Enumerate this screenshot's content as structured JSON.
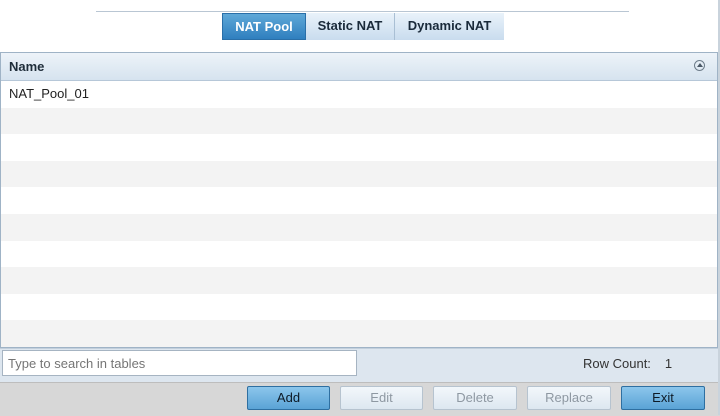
{
  "tabs": [
    {
      "label": "NAT Pool",
      "active": true
    },
    {
      "label": "Static NAT",
      "active": false
    },
    {
      "label": "Dynamic NAT",
      "active": false
    }
  ],
  "table": {
    "column_header": "Name",
    "sort_icon": "sort-ascending-icon",
    "rows": [
      "NAT_Pool_01",
      "",
      "",
      "",
      "",
      "",
      "",
      "",
      "",
      ""
    ]
  },
  "search": {
    "placeholder": "Type to search in tables",
    "value": ""
  },
  "row_count": {
    "label": "Row Count:",
    "value": "1"
  },
  "buttons": {
    "add": "Add",
    "edit": "Edit",
    "delete": "Delete",
    "replace": "Replace",
    "exit": "Exit"
  },
  "colors": {
    "accent": "#2f7fbf",
    "header_bg": "#d6e3ef",
    "footer_bg": "#dde6ef"
  }
}
